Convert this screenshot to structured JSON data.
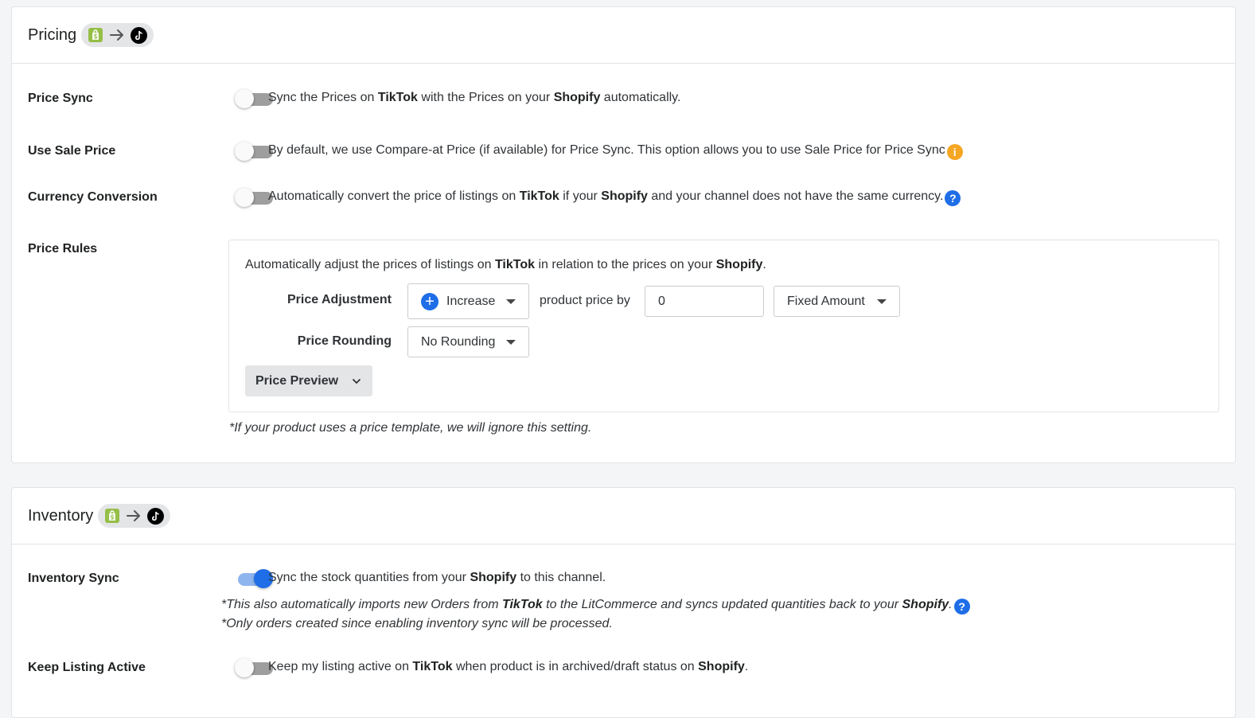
{
  "pricing": {
    "title": "Pricing",
    "price_sync": {
      "label": "Price Sync",
      "enabled": false,
      "desc_pre": "Sync the Prices on ",
      "desc_b1": "TikTok",
      "desc_mid": " with the Prices on your ",
      "desc_b2": "Shopify",
      "desc_post": " automatically."
    },
    "use_sale_price": {
      "label": "Use Sale Price",
      "enabled": false,
      "desc": "By default, we use Compare-at Price (if available) for Price Sync. This option allows you to use Sale Price for Price Sync",
      "info_glyph": "i"
    },
    "currency_conversion": {
      "label": "Currency Conversion",
      "enabled": false,
      "desc_pre": "Automatically convert the price of listings on ",
      "desc_b1": "TikTok",
      "desc_mid": " if your ",
      "desc_b2": "Shopify",
      "desc_post": " and your channel does not have the same currency.",
      "help_glyph": "?"
    },
    "price_rules": {
      "label": "Price Rules",
      "intro_pre": "Automatically adjust the prices of listings on ",
      "intro_b1": "TikTok",
      "intro_mid": " in relation to the prices on your ",
      "intro_b2": "Shopify",
      "intro_post": ".",
      "adjustment_label": "Price Adjustment",
      "adjustment_value": "Increase",
      "adjustment_icon": "plus-circle-icon",
      "product_price_by": "product price by",
      "amount_value": "0",
      "amount_type": "Fixed Amount",
      "rounding_label": "Price Rounding",
      "rounding_value": "No Rounding",
      "preview_button": "Price Preview",
      "note": "*If your product uses a price template, we will ignore this setting."
    }
  },
  "inventory": {
    "title": "Inventory",
    "inventory_sync": {
      "label": "Inventory Sync",
      "enabled": true,
      "desc_pre": "Sync the stock quantities from your ",
      "desc_b1": "Shopify",
      "desc_post": " to this channel.",
      "note1_pre": "*This also automatically imports new Orders from ",
      "note1_b1": "TikTok",
      "note1_mid": " to the LitCommerce and syncs updated quantities back to your ",
      "note1_b2": "Shopify",
      "note1_post": ".",
      "note2": "*Only orders created since enabling inventory sync will be processed.",
      "help_glyph": "?"
    },
    "keep_listing_active": {
      "label": "Keep Listing Active",
      "enabled": false,
      "desc_pre": "Keep my listing active on ",
      "desc_b1": "TikTok",
      "desc_mid": " when product is in archived/draft status on ",
      "desc_b2": "Shopify",
      "desc_post": "."
    }
  },
  "icons": {
    "source": "shopify-icon",
    "arrow": "arrow-right-icon",
    "target": "tiktok-icon"
  },
  "colors": {
    "toggle_on": "#1f6ee8",
    "info_orange": "#f5a623",
    "help_blue": "#1f6ee8",
    "shopify_green": "#95bf47"
  }
}
